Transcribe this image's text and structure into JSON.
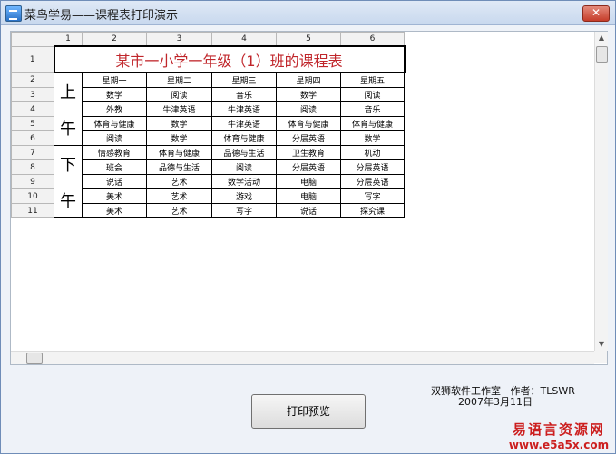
{
  "window": {
    "title": "菜鸟学易——课程表打印演示",
    "close_label": "✕"
  },
  "sheet": {
    "col_headers": [
      "1",
      "2",
      "3",
      "4",
      "5",
      "6"
    ],
    "row_headers": [
      "1",
      "2",
      "3",
      "4",
      "5",
      "6",
      "7",
      "8",
      "9",
      "10",
      "11"
    ],
    "title": "某市一小学一年级（1）班的课程表",
    "period_am": [
      "上",
      "午"
    ],
    "period_pm": [
      "下",
      "午"
    ],
    "weekdays": [
      "星期一",
      "星期二",
      "星期三",
      "星期四",
      "星期五"
    ],
    "rows": [
      [
        "数学",
        "阅读",
        "音乐",
        "数学",
        "阅读"
      ],
      [
        "外教",
        "牛津英语",
        "牛津英语",
        "阅读",
        "音乐"
      ],
      [
        "体育与健康",
        "数学",
        "牛津英语",
        "体育与健康",
        "体育与健康"
      ],
      [
        "阅读",
        "数学",
        "体育与健康",
        "分层英语",
        "数学"
      ],
      [
        "情感教育",
        "体育与健康",
        "品德与生活",
        "卫生教育",
        "机动"
      ],
      [
        "班会",
        "品德与生活",
        "阅读",
        "分层英语",
        "分层英语"
      ],
      [
        "说话",
        "艺术",
        "数学活动",
        "电脑",
        "分层英语"
      ],
      [
        "美术",
        "艺术",
        "游戏",
        "电脑",
        "写字"
      ],
      [
        "美术",
        "艺术",
        "写字",
        "说话",
        "探究课"
      ]
    ]
  },
  "credits": {
    "studio": "双狮软件工作室",
    "author": "作者：TLSWR",
    "date": "2007年3月11日"
  },
  "buttons": {
    "print_preview": "打印预览"
  },
  "watermark": {
    "line1": "易语言资源网",
    "line2": "www.e5a5x.com"
  },
  "colors": {
    "title_red": "#c0262b",
    "watermark_red": "#cc1f1f"
  }
}
